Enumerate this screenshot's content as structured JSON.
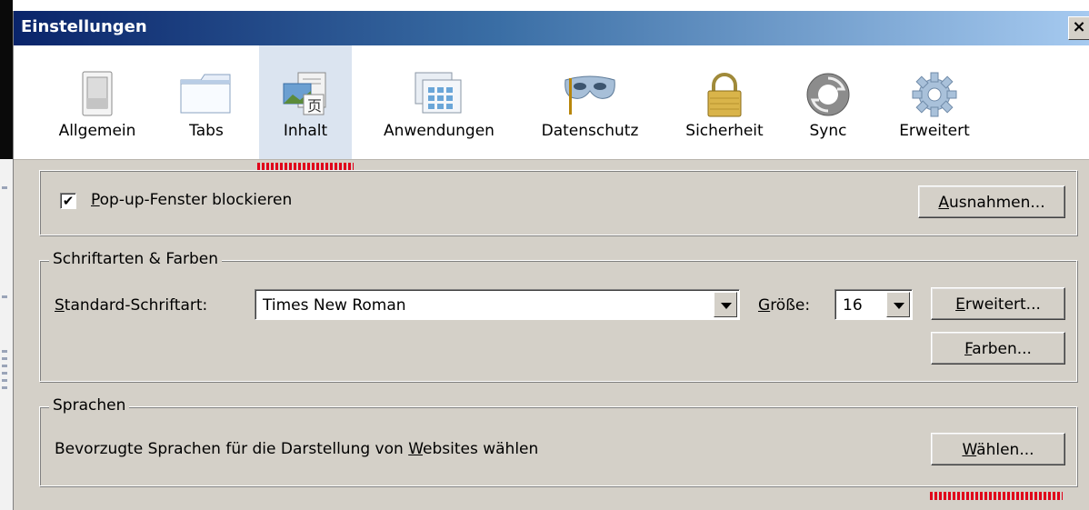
{
  "window": {
    "title": "Einstellungen",
    "close_label": "×"
  },
  "toolbar": {
    "tabs": [
      {
        "label": "Allgemein",
        "icon": "switch-icon"
      },
      {
        "label": "Tabs",
        "icon": "tabs-window-icon"
      },
      {
        "label": "Inhalt",
        "icon": "content-icon",
        "selected": true
      },
      {
        "label": "Anwendungen",
        "icon": "applications-icon"
      },
      {
        "label": "Datenschutz",
        "icon": "privacy-mask-icon"
      },
      {
        "label": "Sicherheit",
        "icon": "padlock-icon"
      },
      {
        "label": "Sync",
        "icon": "sync-icon"
      },
      {
        "label": "Erweitert",
        "icon": "gear-icon"
      }
    ]
  },
  "popup": {
    "checkbox_label": "Pop-up-Fenster blockieren",
    "checked": true,
    "exceptions_button": "Ausnahmen..."
  },
  "fonts": {
    "legend": "Schriftarten & Farben",
    "default_font_label": "Standard-Schriftart:",
    "default_font_value": "Times New Roman",
    "size_label": "Größe:",
    "size_value": "16",
    "advanced_button": "Erweitert...",
    "colors_button": "Farben..."
  },
  "languages": {
    "legend": "Sprachen",
    "description": "Bevorzugte Sprachen für die Darstellung von Websites wählen",
    "choose_button": "Wählen..."
  },
  "colors": {
    "accent": "#0a246a",
    "marker": "#e0001a",
    "panel": "#d4d0c8"
  }
}
